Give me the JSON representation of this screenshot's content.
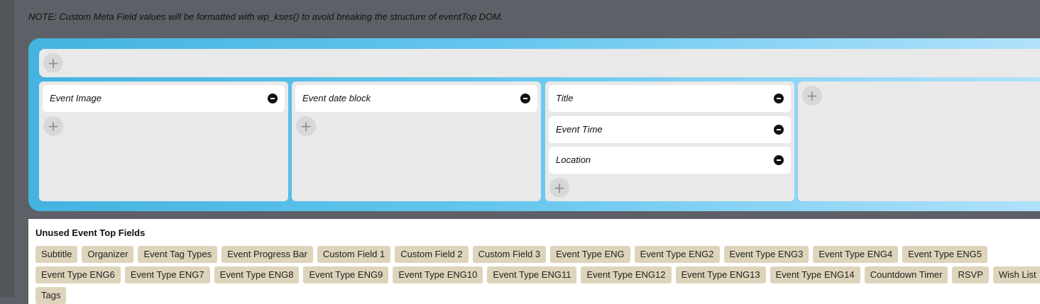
{
  "note": "NOTE: Custom Meta Field values will be formatted with wp_kses() to avoid breaking the structure of eventTop DOM.",
  "icons": {
    "add": "plus-icon",
    "remove": "minus-circle-icon"
  },
  "layout": {
    "add_label": "+",
    "columns": [
      {
        "fields": [
          "Event Image"
        ]
      },
      {
        "fields": [
          "Event date block"
        ]
      },
      {
        "fields": [
          "Title",
          "Event Time",
          "Location"
        ]
      },
      {
        "fields": []
      }
    ]
  },
  "unused": {
    "title": "Unused Event Top Fields",
    "items": [
      "Subtitle",
      "Organizer",
      "Event Tag Types",
      "Event Progress Bar",
      "Custom Field 1",
      "Custom Field 2",
      "Custom Field 3",
      "Event Type ENG",
      "Event Type ENG2",
      "Event Type ENG3",
      "Event Type ENG4",
      "Event Type ENG5",
      "Event Type ENG6",
      "Event Type ENG7",
      "Event Type ENG8",
      "Event Type ENG9",
      "Event Type ENG10",
      "Event Type ENG11",
      "Event Type ENG12",
      "Event Type ENG13",
      "Event Type ENG14",
      "Countdown Timer",
      "RSVP",
      "Wish List",
      "Tags"
    ]
  }
}
